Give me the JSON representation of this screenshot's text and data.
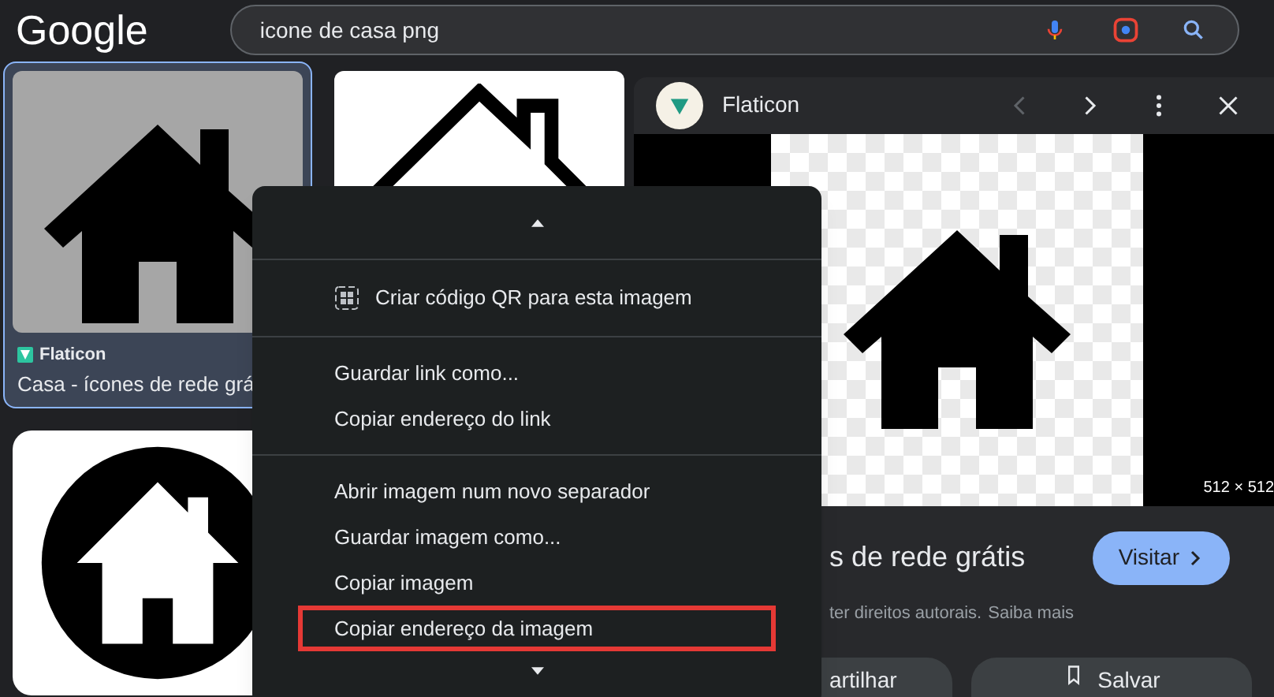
{
  "header": {
    "logo": "Google",
    "search": {
      "value": "icone de casa png"
    }
  },
  "results": [
    {
      "kind": "filled",
      "selected": true,
      "source": "Flaticon",
      "title": "Casa - ícones de rede grá"
    },
    {
      "kind": "outline",
      "selected": false
    },
    {
      "kind": "circle",
      "selected": false
    }
  ],
  "panel": {
    "source": "Flaticon",
    "prev_disabled": true,
    "image_size": "512 × 512",
    "title": "s de rede grátis",
    "visit": "Visitar",
    "notice": "ter direitos autorais.",
    "notice_link": "Saiba mais",
    "buttons": [
      {
        "kind": "share",
        "label": "artilhar"
      },
      {
        "kind": "save",
        "label": "Salvar"
      }
    ]
  },
  "context_menu": {
    "groups": [
      [
        {
          "kind": "qr",
          "label": "Criar código QR para esta imagem",
          "highlighted": false
        }
      ],
      [
        {
          "kind": "plain",
          "label": "Guardar link como...",
          "highlighted": false
        },
        {
          "kind": "plain",
          "label": "Copiar endereço do link",
          "highlighted": false
        }
      ],
      [
        {
          "kind": "plain",
          "label": "Abrir imagem num novo separador",
          "highlighted": false
        },
        {
          "kind": "plain",
          "label": "Guardar imagem como...",
          "highlighted": false
        },
        {
          "kind": "plain",
          "label": "Copiar imagem",
          "highlighted": false
        },
        {
          "kind": "plain",
          "label": "Copiar endereço da imagem",
          "highlighted": true
        }
      ]
    ]
  }
}
